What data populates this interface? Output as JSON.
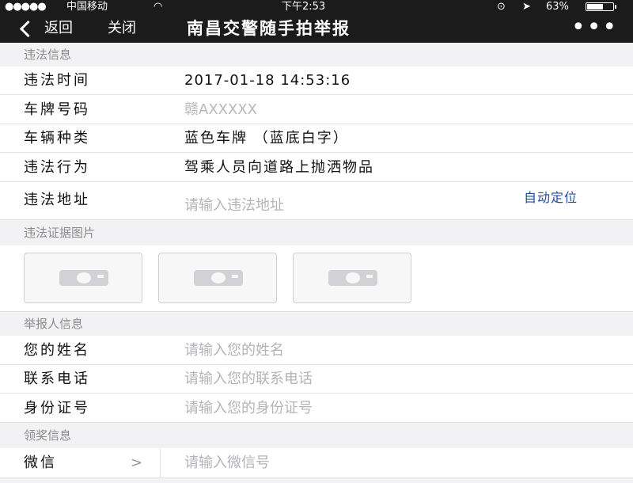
{
  "status_bar": {
    "carrier": "中国移动",
    "time": "下午2:53",
    "battery_percent": "63%",
    "battery_level": 0.63
  },
  "nav": {
    "back_label": "返回",
    "close_label": "关闭",
    "title": "南昌交警随手拍举报",
    "more_glyph": "•••"
  },
  "violation": {
    "header": "违法信息",
    "time_label": "违法时间",
    "time_value": "2017-01-18 14:53:16",
    "plate_label": "车牌号码",
    "plate_value": "赣AXXXXX",
    "vehicle_label": "车辆种类",
    "vehicle_value": "蓝色车牌 （蓝底白字）",
    "behavior_label": "违法行为",
    "behavior_value": "驾乘人员向道路上抛洒物品",
    "address_label": "违法地址",
    "address_placeholder": "请输入违法地址",
    "locate_label": "自动定位"
  },
  "evidence": {
    "header": "违法证据图片"
  },
  "reporter": {
    "header": "举报人信息",
    "name_label": "您的姓名",
    "name_placeholder": "请输入您的姓名",
    "phone_label": "联系电话",
    "phone_placeholder": "请输入您的联系电话",
    "id_label": "身份证号",
    "id_placeholder": "请输入您的身份证号"
  },
  "reward": {
    "header": "领奖信息",
    "wechat_label": "微信",
    "wechat_chevron": ">",
    "wechat_placeholder": "请输入微信号"
  }
}
